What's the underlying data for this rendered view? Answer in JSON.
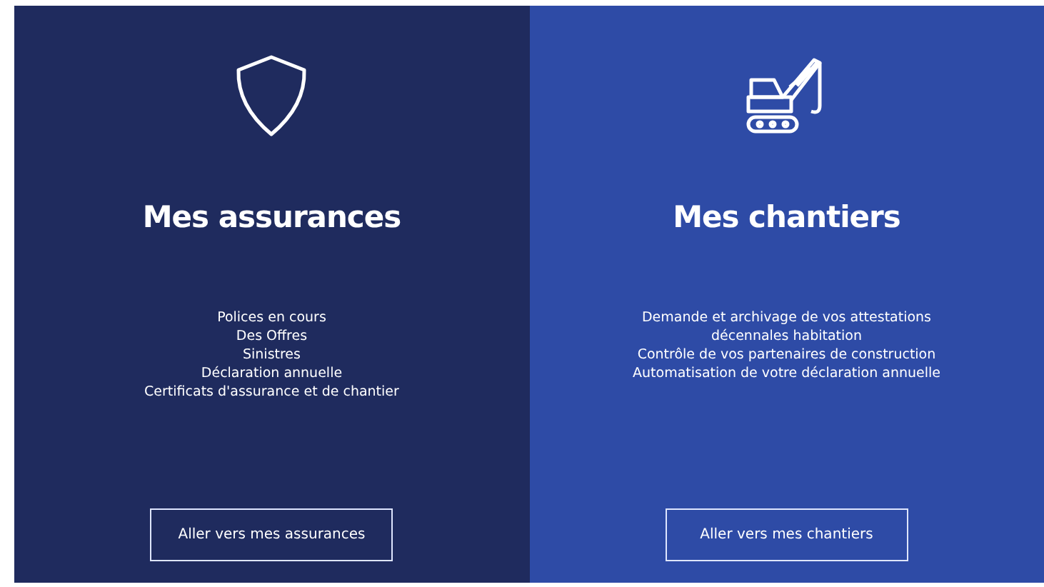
{
  "panels": [
    {
      "title": "Mes assurances",
      "items": [
        "Polices en cours",
        "Des Offres",
        "Sinistres",
        "Déclaration annuelle",
        "Certificats d'assurance et de chantier"
      ],
      "button": "Aller vers mes assurances"
    },
    {
      "title": "Mes chantiers",
      "items": [
        "Demande et archivage de vos attestations décennales habitation",
        "Contrôle de vos partenaires de construction",
        "Automatisation de votre déclaration annuelle"
      ],
      "button": "Aller vers mes chantiers"
    }
  ]
}
